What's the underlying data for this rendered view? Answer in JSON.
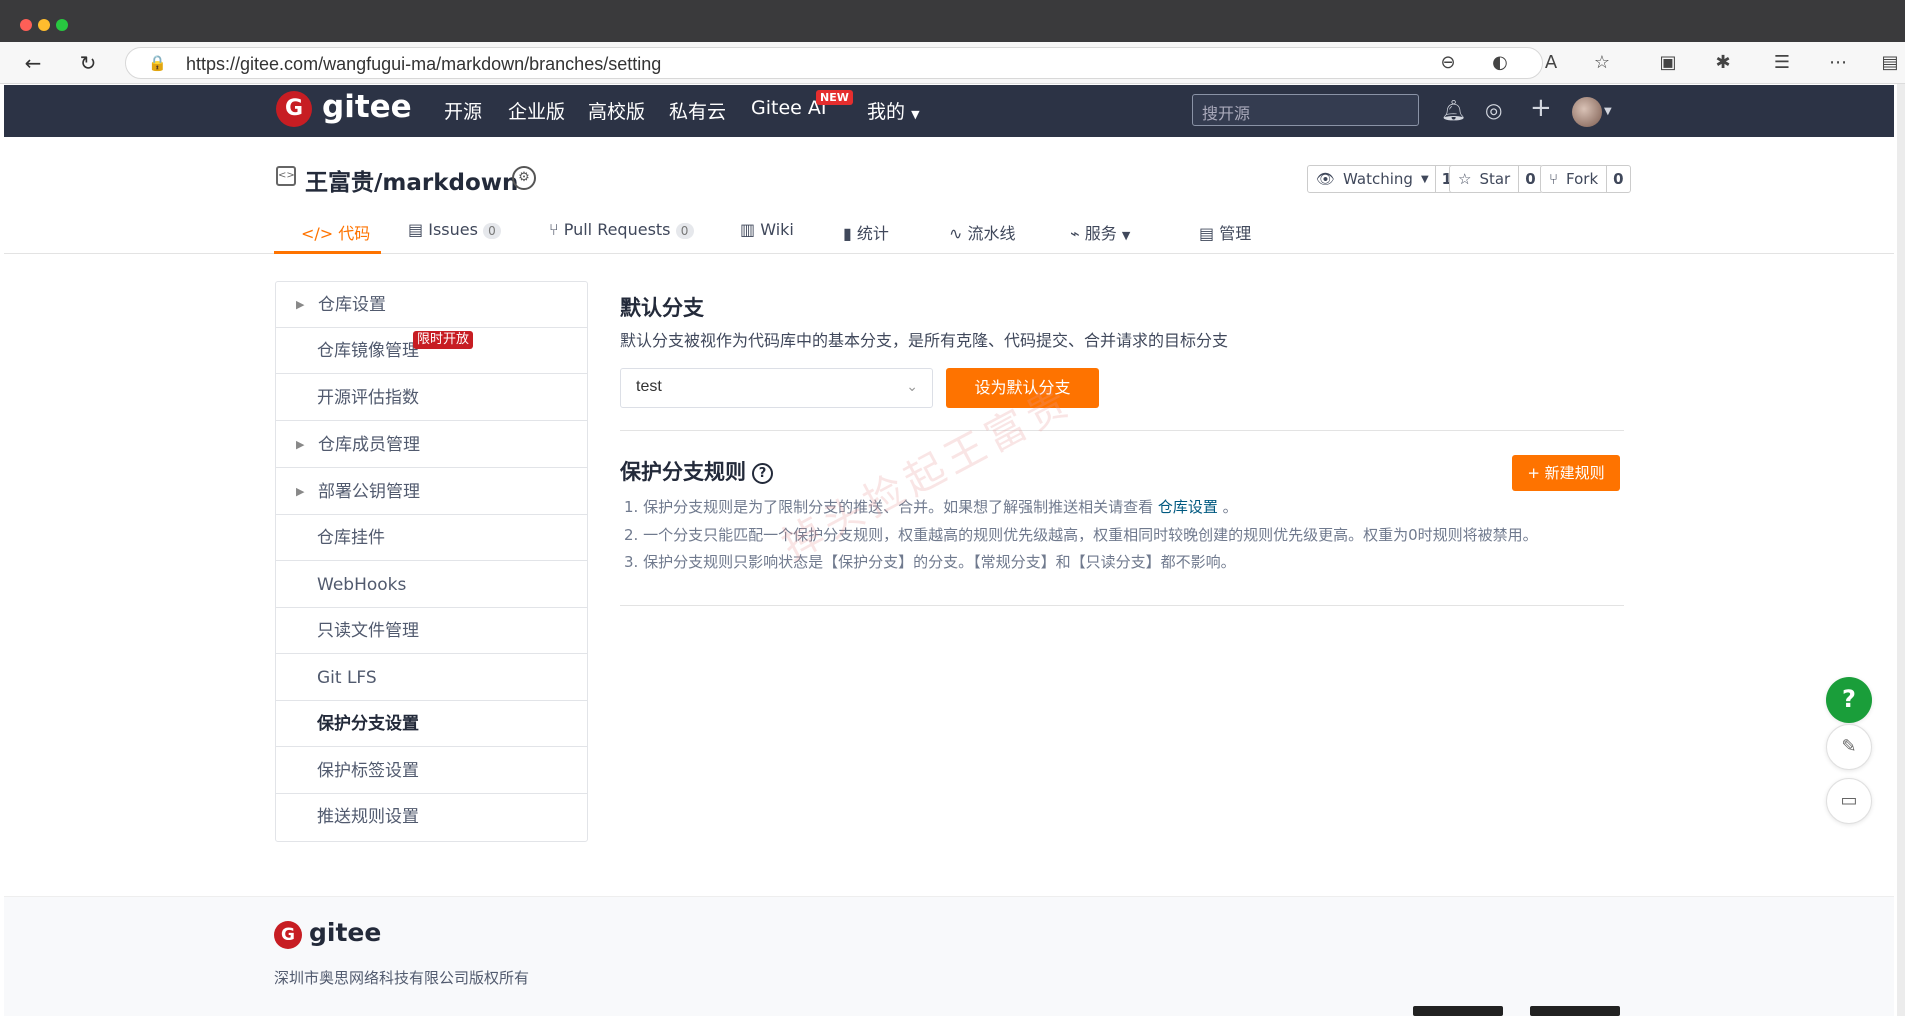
{
  "browser": {
    "url": "https://gitee.com/wangfugui-ma/markdown/branches/setting"
  },
  "topnav": {
    "logo_text": "gitee",
    "logo_letter": "G",
    "items": [
      "开源",
      "企业版",
      "高校版",
      "私有云",
      "Gitee AI",
      "我的"
    ],
    "new_badge": "NEW",
    "search_placeholder": "搜开源"
  },
  "repo": {
    "title": "王富贵/markdown",
    "watching_label": "Watching",
    "watching_count": "1",
    "star_label": "Star",
    "star_count": "0",
    "fork_label": "Fork",
    "fork_count": "0"
  },
  "tabs": [
    {
      "label": "代码"
    },
    {
      "label": "Issues",
      "count": "0"
    },
    {
      "label": "Pull Requests",
      "count": "0"
    },
    {
      "label": "Wiki"
    },
    {
      "label": "统计"
    },
    {
      "label": "流水线"
    },
    {
      "label": "服务"
    },
    {
      "label": "管理"
    }
  ],
  "sidebar": {
    "items": [
      "仓库设置",
      "仓库镜像管理",
      "开源评估指数",
      "仓库成员管理",
      "部署公钥管理",
      "仓库挂件",
      "WebHooks",
      "只读文件管理",
      "Git LFS",
      "保护分支设置",
      "保护标签设置",
      "推送规则设置"
    ],
    "limit_badge": "限时开放"
  },
  "default_branch": {
    "title": "默认分支",
    "description": "默认分支被视作为代码库中的基本分支，是所有克隆、代码提交、合并请求的目标分支",
    "selected": "test",
    "button": "设为默认分支"
  },
  "protect": {
    "title": "保护分支规则",
    "new_rule_button": "+ 新建规则",
    "rule1_pre": "1. 保护分支规则是为了限制分支的推送、合并。如果想了解强制推送相关请查看",
    "rule1_link": "仓库设置",
    "rule1_post": "。",
    "rule2": "2. 一个分支只能匹配一个保护分支规则，权重越高的规则优先级越高，权重相同时较晚创建的规则优先级更高。权重为0时规则将被禁用。",
    "rule3": "3. 保护分支规则只影响状态是【保护分支】的分支。【常规分支】和【只读分支】都不影响。"
  },
  "watermark": "掉头捡起王富贵",
  "footer": {
    "logo_text": "gitee",
    "copyright": "深圳市奥思网络科技有限公司版权所有"
  },
  "colors": {
    "accent": "#fe7300",
    "brand": "#c71d23",
    "navbar": "#2c3345"
  }
}
